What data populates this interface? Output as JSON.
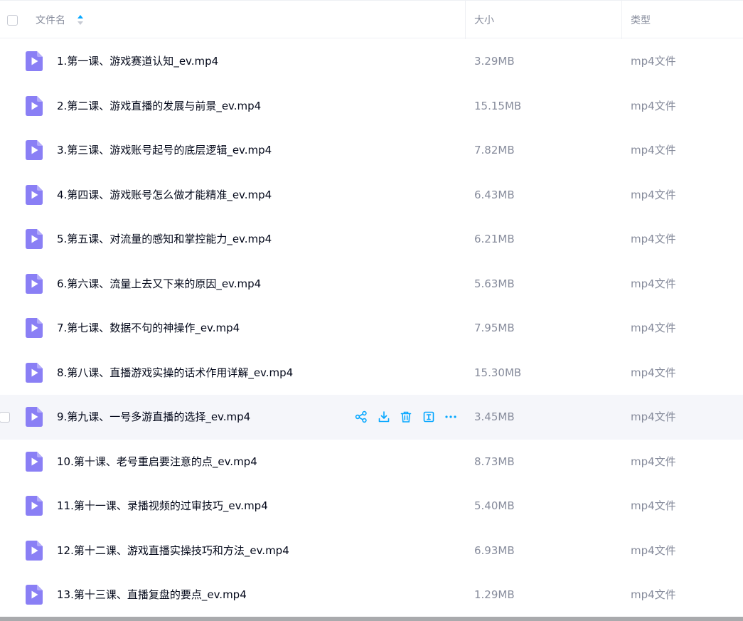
{
  "header": {
    "name_label": "文件名",
    "size_label": "大小",
    "type_label": "类型"
  },
  "accent_color": "#06a7ff",
  "file_icon_color": "#8a7ff5",
  "files": [
    {
      "name": "1.第一课、游戏赛道认知_ev.mp4",
      "size": "3.29MB",
      "type": "mp4文件"
    },
    {
      "name": "2.第二课、游戏直播的发展与前景_ev.mp4",
      "size": "15.15MB",
      "type": "mp4文件"
    },
    {
      "name": "3.第三课、游戏账号起号的底层逻辑_ev.mp4",
      "size": "7.82MB",
      "type": "mp4文件"
    },
    {
      "name": "4.第四课、游戏账号怎么做才能精准_ev.mp4",
      "size": "6.43MB",
      "type": "mp4文件"
    },
    {
      "name": "5.第五课、对流量的感知和掌控能力_ev.mp4",
      "size": "6.21MB",
      "type": "mp4文件"
    },
    {
      "name": "6.第六课、流量上去又下来的原因_ev.mp4",
      "size": "5.63MB",
      "type": "mp4文件"
    },
    {
      "name": "7.第七课、数据不句的神操作_ev.mp4",
      "size": "7.95MB",
      "type": "mp4文件"
    },
    {
      "name": "8.第八课、直播游戏实操的话术作用详解_ev.mp4",
      "size": "15.30MB",
      "type": "mp4文件"
    },
    {
      "name": "9.第九课、一号多游直播的选择_ev.mp4",
      "size": "3.45MB",
      "type": "mp4文件"
    },
    {
      "name": "10.第十课、老号重启要注意的点_ev.mp4",
      "size": "8.73MB",
      "type": "mp4文件"
    },
    {
      "name": "11.第十一课、录播视频的过审技巧_ev.mp4",
      "size": "5.40MB",
      "type": "mp4文件"
    },
    {
      "name": "12.第十二课、游戏直播实操技巧和方法_ev.mp4",
      "size": "6.93MB",
      "type": "mp4文件"
    },
    {
      "name": "13.第十三课、直播复盘的要点_ev.mp4",
      "size": "1.29MB",
      "type": "mp4文件"
    }
  ],
  "hovered_row_index": 8,
  "row_actions": [
    "share-icon",
    "download-icon",
    "delete-icon",
    "rename-icon",
    "more-icon"
  ]
}
